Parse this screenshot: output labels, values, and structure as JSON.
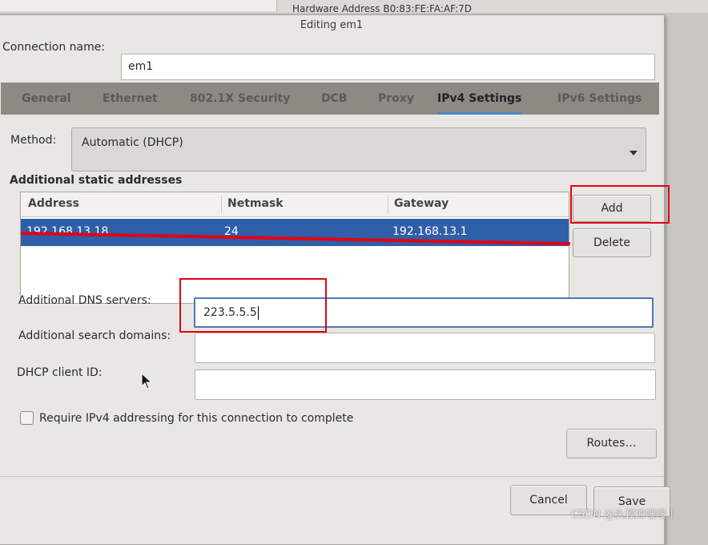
{
  "background": {
    "hardware_address_text": "Hardware Address B0:83:FE:FA:AF:7D"
  },
  "dialog": {
    "title": "Editing em1",
    "connection_name_label": "Connection name:",
    "connection_name_value": "em1"
  },
  "tabs": [
    {
      "label": "General",
      "active": false
    },
    {
      "label": "Ethernet",
      "active": false
    },
    {
      "label": "802.1X Security",
      "active": false
    },
    {
      "label": "DCB",
      "active": false
    },
    {
      "label": "Proxy",
      "active": false
    },
    {
      "label": "IPv4 Settings",
      "active": true
    },
    {
      "label": "IPv6 Settings",
      "active": false
    }
  ],
  "ipv4": {
    "method_label": "Method:",
    "method_value": "Automatic (DHCP)",
    "static_addresses_title": "Additional static addresses",
    "columns": [
      "Address",
      "Netmask",
      "Gateway"
    ],
    "rows": [
      {
        "address": "192.168.13.18",
        "netmask": "24",
        "gateway": "192.168.13.1"
      }
    ],
    "add_label": "Add",
    "delete_label": "Delete",
    "dns_label": "Additional DNS servers:",
    "dns_value": "223.5.5.5",
    "search_domains_label": "Additional search domains:",
    "search_domains_value": "",
    "dhcp_client_id_label": "DHCP client ID:",
    "dhcp_client_id_value": "",
    "require_ipv4_label": "Require IPv4 addressing for this connection to complete",
    "require_ipv4_checked": false,
    "routes_label": "Routes…"
  },
  "footer": {
    "cancel_label": "Cancel",
    "save_label": "Save"
  },
  "watermark": "CSDN @头顶凉嗖嗖丨",
  "colors": {
    "selection": "#2f5fa8",
    "annotation_red": "#e60012",
    "focus_border": "#4a7ab8"
  }
}
